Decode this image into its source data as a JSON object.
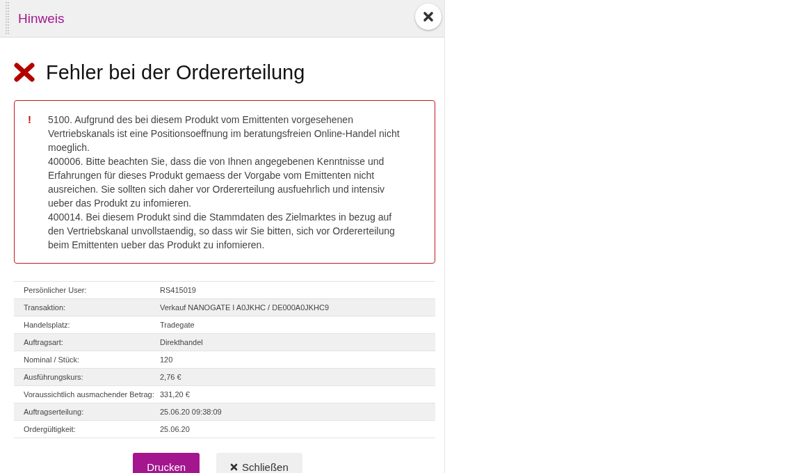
{
  "dialog": {
    "title": "Hinweis"
  },
  "heading": "Fehler bei der Ordererteilung",
  "alert": {
    "icon": "!",
    "messages": [
      "5100. Aufgrund des bei diesem Produkt vom Emittenten vorgesehenen Vertriebskanals ist eine Positionsoeffnung im beratungsfreien Online-Handel nicht moeglich.",
      "400006. Bitte beachten Sie, dass die von Ihnen angegebenen Kenntnisse und Erfahrungen für dieses Produkt gemaess der Vorgabe vom Emittenten nicht ausreichen. Sie sollten sich daher vor Ordererteilung ausfuehrlich und intensiv ueber das Produkt zu infomieren.",
      "400014. Bei diesem Produkt sind die Stammdaten des Zielmarktes in bezug auf den Vertriebskanal unvollstaendig, so dass wir Sie bitten, sich vor Ordererteilung beim Emittenten ueber das Produkt zu infomieren."
    ]
  },
  "details": [
    {
      "label": "Persönlicher User:",
      "value": "RS415019"
    },
    {
      "label": "Transaktion:",
      "value": "Verkauf NANOGATE I A0JKHC / DE000A0JKHC9"
    },
    {
      "label": "Handelsplatz:",
      "value": "Tradegate"
    },
    {
      "label": "Auftragsart:",
      "value": "Direkthandel"
    },
    {
      "label": "Nominal / Stück:",
      "value": "120"
    },
    {
      "label": "Ausführungskurs:",
      "value": "2,76 €"
    },
    {
      "label": "Voraussichtlich ausmachender Betrag:",
      "value": "331,20 €"
    },
    {
      "label": "Auftragserteilung:",
      "value": "25.06.20 09:38:09"
    },
    {
      "label": "Ordergültigkeit:",
      "value": "25.06.20"
    }
  ],
  "buttons": [
    {
      "label": "Drucken",
      "kind": "primary"
    },
    {
      "label": "Schließen",
      "kind": "close"
    }
  ]
}
